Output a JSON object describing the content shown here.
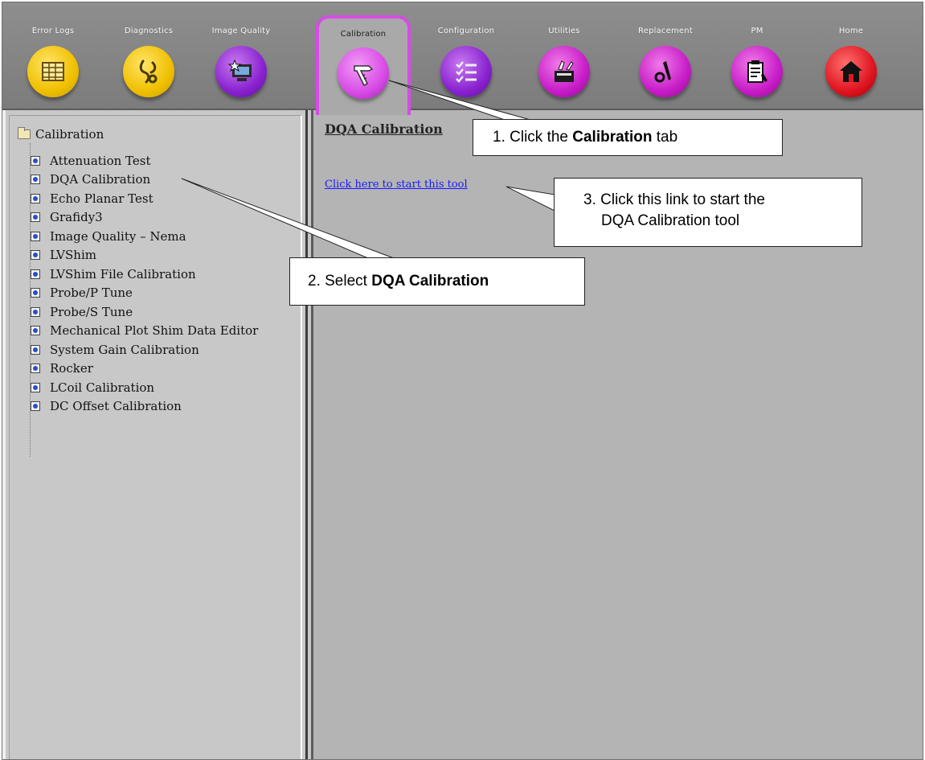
{
  "tabs": [
    {
      "label": "Error Logs",
      "icon": "grid-icon",
      "color": "#f4c600"
    },
    {
      "label": "Diagnostics",
      "icon": "stethoscope-icon",
      "color": "#f4c600"
    },
    {
      "label": "Image Quality",
      "icon": "monitor-star-icon",
      "color": "#9a2ed6"
    },
    {
      "label": "Calibration",
      "icon": "caliper-icon",
      "color": "#d64be6",
      "active": true
    },
    {
      "label": "Configuration",
      "icon": "checklist-icon",
      "color": "#9a2ed6"
    },
    {
      "label": "Utilities",
      "icon": "toolbox-icon",
      "color": "#cc22cc"
    },
    {
      "label": "Replacement",
      "icon": "wrench-icon",
      "color": "#cc22cc"
    },
    {
      "label": "PM",
      "icon": "clipboard-icon",
      "color": "#cc22cc"
    },
    {
      "label": "Home",
      "icon": "home-icon",
      "color": "#e0151f"
    }
  ],
  "sidebar": {
    "root_label": "Calibration",
    "items": [
      "Attenuation Test",
      "DQA Calibration",
      "Echo Planar Test",
      "Grafidy3",
      "Image Quality – Nema",
      "LVShim",
      "LVShim File Calibration",
      "Probe/P Tune",
      "Probe/S Tune",
      "Mechanical Plot Shim Data Editor",
      "System Gain Calibration",
      "Rocker",
      "LCoil Calibration",
      "DC Offset Calibration"
    ]
  },
  "main": {
    "title": "DQA Calibration",
    "link_text": "Click here to start this tool"
  },
  "callouts": {
    "step1_prefix": "1.  Click the ",
    "step1_bold": "Calibration",
    "step1_suffix": " tab",
    "step2_prefix": "2.  Select ",
    "step2_bold": "DQA Calibration",
    "step3_line1": "3.  Click this link to start the",
    "step3_line2": "DQA Calibration tool"
  }
}
